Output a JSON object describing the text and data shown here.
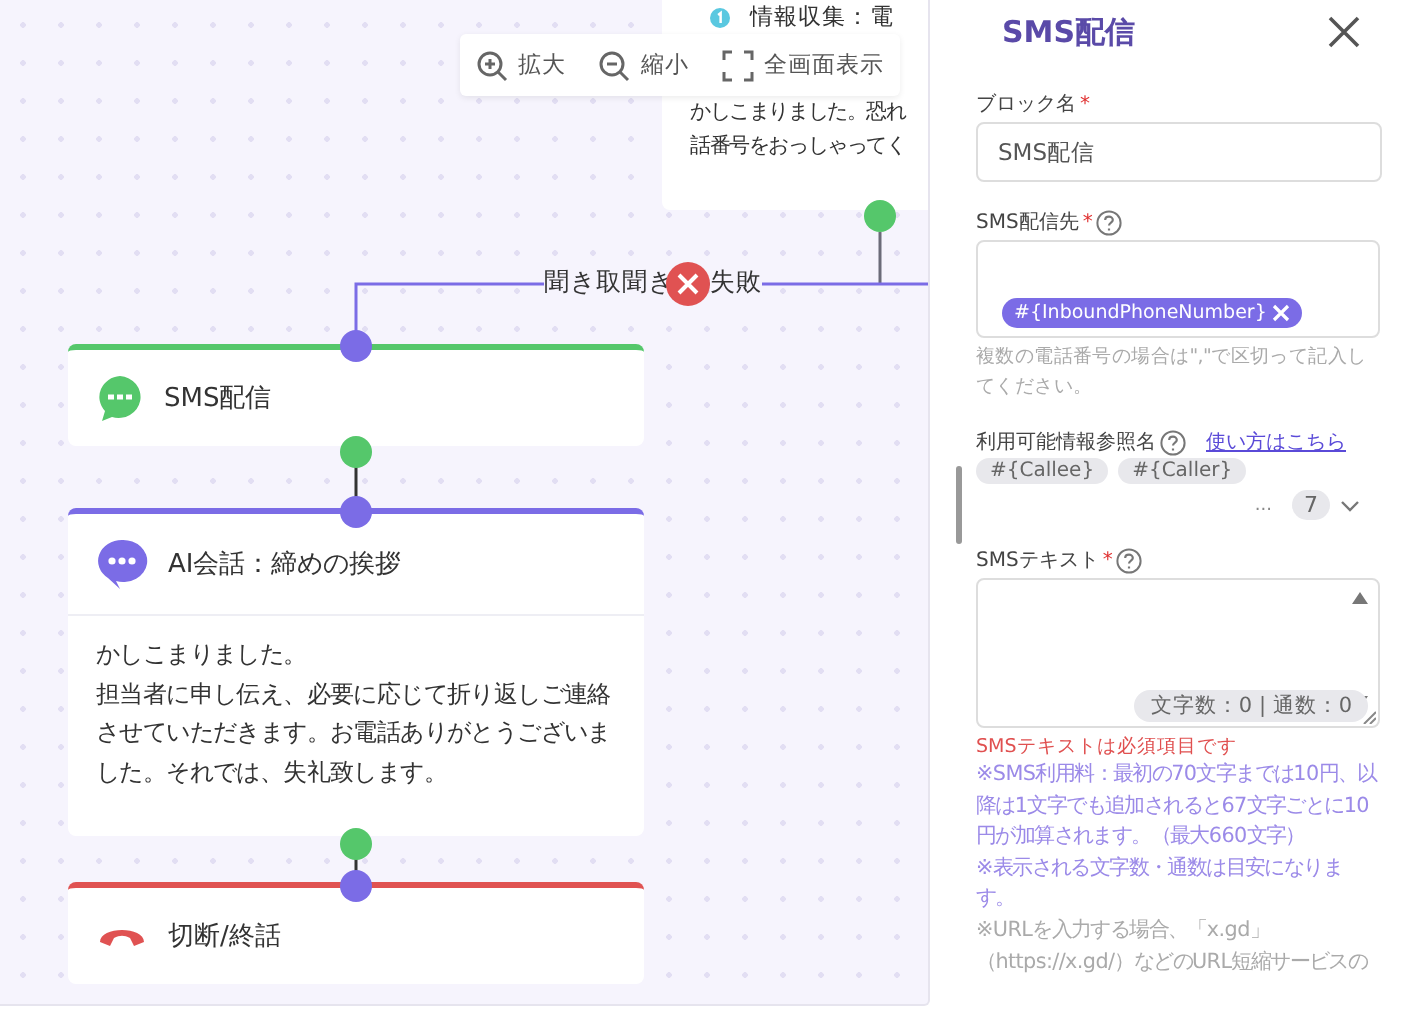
{
  "canvas": {
    "toolbar": [
      {
        "kind": "zoom-in",
        "label": "拡大"
      },
      {
        "kind": "zoom-out",
        "label": "縮小"
      },
      {
        "kind": "fullscreen",
        "label": "全画面表示"
      }
    ],
    "nodes": [
      {
        "kind": "info",
        "title": "情報収集：電",
        "body": [
          "かしこまりました。恐れ",
          "話番号をおっしゃってく"
        ]
      },
      {
        "kind": "sms",
        "title": "SMS配信"
      },
      {
        "kind": "ai",
        "title": "AI会話：締めの挨拶",
        "body": [
          "かしこまりました。",
          "担当者に申し伝え、必要に応じて折り返しご連絡させていただきます。お電話ありがとうございました。それでは、失礼致します。"
        ]
      },
      {
        "kind": "hangup",
        "title": "切断/終話"
      }
    ],
    "edge_labels": [
      "聞き取聞き",
      "失敗"
    ]
  },
  "panel": {
    "title": "SMS配信",
    "block_name": {
      "label": "ブロック名",
      "required_mark": "*",
      "value": "SMS配信"
    },
    "recipients": {
      "label": "SMS配信先",
      "required_mark": "*",
      "chips": [
        "#{InboundPhoneNumber}"
      ],
      "hint": "複数の電話番号の場合は\",\"で区切って記入してください。"
    },
    "references": {
      "label": "利用可能情報参照名",
      "link": "使い方はこちら",
      "chips": [
        "#{Callee}",
        "#{Caller}"
      ],
      "more": "...",
      "count": "7"
    },
    "sms_text": {
      "label": "SMSテキスト",
      "required_mark": "*",
      "counter": "文字数：0 | 通数：0",
      "error": "SMSテキストは必須項目です"
    },
    "notes": [
      {
        "kind": "info",
        "text": "※SMS利用料：最初の70文字までは10円、以降は1文字でも追加されると67文字ごとに10円が加算されます。（最大660文字）"
      },
      {
        "kind": "info",
        "text": "※表示される文字数・通数は目安になります。"
      },
      {
        "kind": "muted",
        "text": "※URLを入力する場合、「x.gd」（https://x.gd/）などのURL短縮サービスの"
      }
    ]
  }
}
